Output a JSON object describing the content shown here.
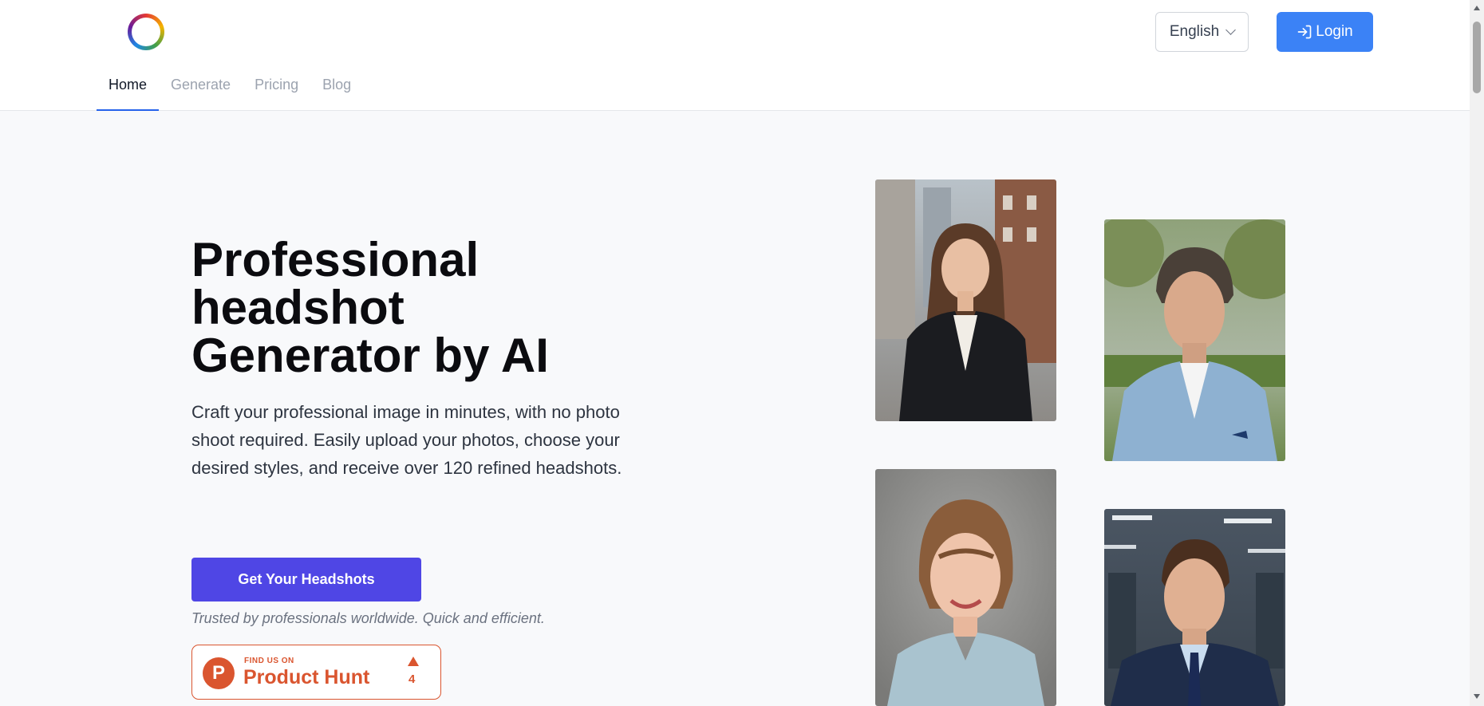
{
  "header": {
    "logo_icon": "rainbow-ring-logo",
    "language": "English",
    "login_label": "Login",
    "login_icon": "sign-in-icon"
  },
  "nav": {
    "tabs": [
      {
        "label": "Home",
        "active": true
      },
      {
        "label": "Generate",
        "active": false
      },
      {
        "label": "Pricing",
        "active": false
      },
      {
        "label": "Blog",
        "active": false
      }
    ]
  },
  "hero": {
    "title_lines": [
      "Professional",
      "headshot",
      "Generator by AI"
    ],
    "description": "Craft your professional image in minutes, with no photo shoot required. Easily upload your photos, choose your desired styles, and receive over 120 refined headshots.",
    "cta_label": "Get Your Headshots",
    "trust_text": "Trusted by professionals worldwide. Quick and efficient."
  },
  "product_hunt": {
    "logo_letter": "P",
    "find_text": "FIND US ON",
    "name": "Product Hunt",
    "upvotes": "4"
  },
  "gallery": {
    "photos": [
      "woman-city-headshot",
      "man-park-headshot",
      "woman-studio-headshot",
      "man-office-headshot"
    ]
  },
  "colors": {
    "primary": "#4f46e5",
    "login": "#3b82f6",
    "product_hunt": "#da552f",
    "nav_active_underline": "#2563eb"
  }
}
